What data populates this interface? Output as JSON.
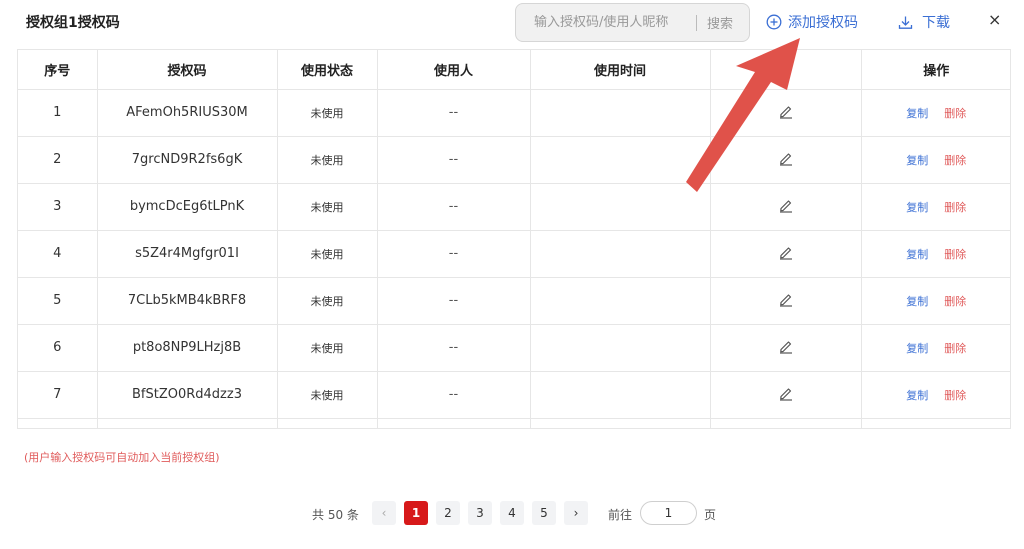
{
  "header": {
    "title": "授权组1授权码",
    "search_placeholder": "输入授权码/使用人昵称",
    "search_button": "搜索",
    "add_label": "添加授权码",
    "download_label": "下载",
    "close_label": "×"
  },
  "table": {
    "columns": [
      "序号",
      "授权码",
      "使用状态",
      "使用人",
      "使用时间",
      "",
      "操作"
    ],
    "rows": [
      {
        "index": "1",
        "code": "AFemOh5RIUS30M",
        "status": "未使用",
        "user": "--",
        "time": ""
      },
      {
        "index": "2",
        "code": "7grcND9R2fs6gK",
        "status": "未使用",
        "user": "--",
        "time": ""
      },
      {
        "index": "3",
        "code": "bymcDcEg6tLPnK",
        "status": "未使用",
        "user": "--",
        "time": ""
      },
      {
        "index": "4",
        "code": "s5Z4r4Mgfgr01I",
        "status": "未使用",
        "user": "--",
        "time": ""
      },
      {
        "index": "5",
        "code": "7CLb5kMB4kBRF8",
        "status": "未使用",
        "user": "--",
        "time": ""
      },
      {
        "index": "6",
        "code": "pt8o8NP9LHzj8B",
        "status": "未使用",
        "user": "--",
        "time": ""
      },
      {
        "index": "7",
        "code": "BfStZO0Rd4dzz3",
        "status": "未使用",
        "user": "--",
        "time": ""
      }
    ],
    "copy_label": "复制",
    "delete_label": "删除",
    "edit_icon": "pencil-icon"
  },
  "note": "(用户输入授权码可自动加入当前授权组)",
  "pagination": {
    "total": "共 50 条",
    "pages": [
      "1",
      "2",
      "3",
      "4",
      "5"
    ],
    "current": "1",
    "prev": "‹",
    "next": "›",
    "goto_label": "前往",
    "goto_value": "1",
    "page_unit": "页"
  },
  "colors": {
    "accent": "#3b6fd4",
    "danger": "#e05b5b",
    "active_page": "#d7191a",
    "annotation_arrow": "#e0524a"
  }
}
